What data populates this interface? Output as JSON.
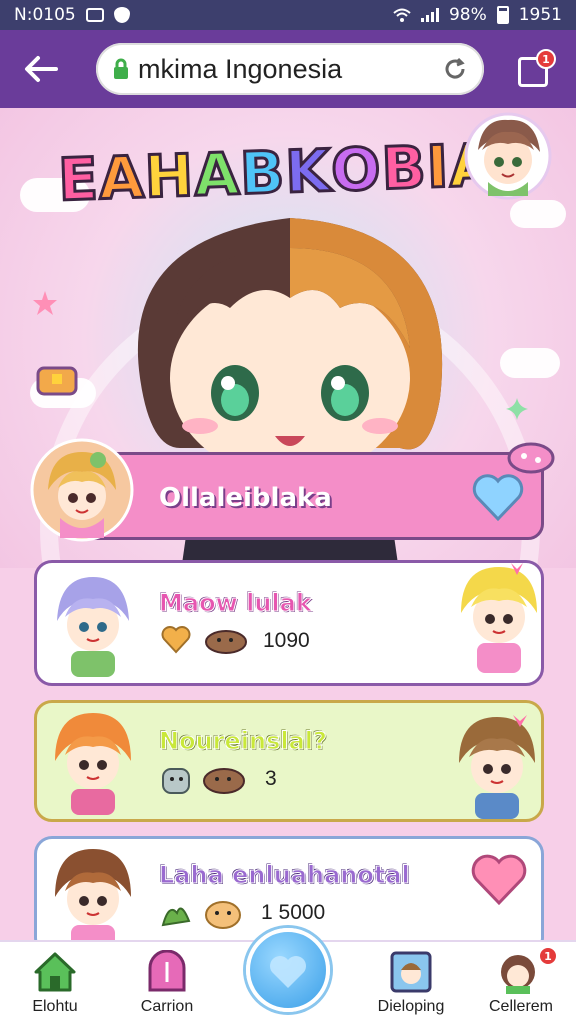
{
  "status_bar": {
    "left_text": "N:0105",
    "battery_text": "98%",
    "time": "1951"
  },
  "browser": {
    "url": "mkima Ingonesia",
    "tab_badge": "1"
  },
  "hero": {
    "logo": "EAHABKOBIAI",
    "logo_colors": [
      "#ff5fa2",
      "#ff9a3c",
      "#ffd23c",
      "#7ee06a",
      "#4fc3f7",
      "#7c6cf0",
      "#c86cf0"
    ]
  },
  "featured": {
    "title": "Ollaleiblaka",
    "heart_color": "#8fd3ff"
  },
  "cards": [
    {
      "title": "Maow lulak",
      "value": "1090",
      "bg": "#ffffff",
      "title_color": "#e656b0"
    },
    {
      "title": "Noureinslal?",
      "value": "3",
      "bg": "#e9f7c8",
      "title_color": "#c9e83a"
    },
    {
      "title": "Laha enluahanotal",
      "value": "1 5000",
      "bg": "#ffffff",
      "title_color": "#9a6ad0"
    }
  ],
  "bottom_nav": {
    "items": [
      {
        "label": "Elohtu",
        "icon": "home-icon"
      },
      {
        "label": "Carrion",
        "icon": "door-icon"
      },
      {
        "label": "Dieloping",
        "icon": "picture-icon"
      },
      {
        "label": "Cellerem",
        "icon": "character-icon",
        "badge": "1"
      }
    ],
    "fab_icon": "heart-bubble-icon"
  },
  "colors": {
    "status_bg": "#3d3f6d",
    "browser_bg": "#6a3c9a",
    "page_bg": "#f7cfe8",
    "accent_pink": "#f48ec8"
  }
}
